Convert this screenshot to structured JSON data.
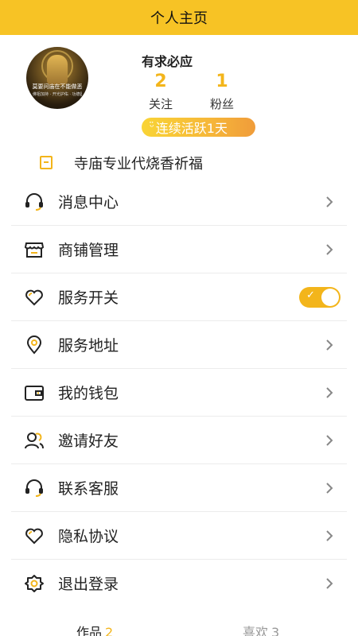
{
  "header": {
    "title": "个人主页"
  },
  "profile": {
    "name": "有求必应",
    "avatar_caption": "莫要问庙在不能做恶",
    "avatar_subcaption": "佛祖加持 · 开光护佑 · 功德圆满",
    "following_count": "2",
    "following_label": "关注",
    "fans_count": "1",
    "fans_label": "粉丝",
    "streak_badge": "连续活跃1天"
  },
  "notice": {
    "text": "寺庙专业代烧香祈福"
  },
  "menu": [
    {
      "label": "消息中心",
      "icon": "headset-icon"
    },
    {
      "label": "商铺管理",
      "icon": "store-icon"
    },
    {
      "label": "服务开关",
      "icon": "heart-icon",
      "toggle": true
    },
    {
      "label": "服务地址",
      "icon": "location-icon"
    },
    {
      "label": "我的钱包",
      "icon": "wallet-icon"
    },
    {
      "label": "邀请好友",
      "icon": "friends-icon"
    },
    {
      "label": "联系客服",
      "icon": "headset-icon"
    },
    {
      "label": "隐私协议",
      "icon": "heart-icon"
    },
    {
      "label": "退出登录",
      "icon": "gear-icon"
    }
  ],
  "tabs": {
    "works_label": "作品",
    "works_count": "2",
    "likes_label": "喜欢",
    "likes_count": "3"
  },
  "colors": {
    "accent": "#f7c325",
    "number": "#f3b51b"
  }
}
